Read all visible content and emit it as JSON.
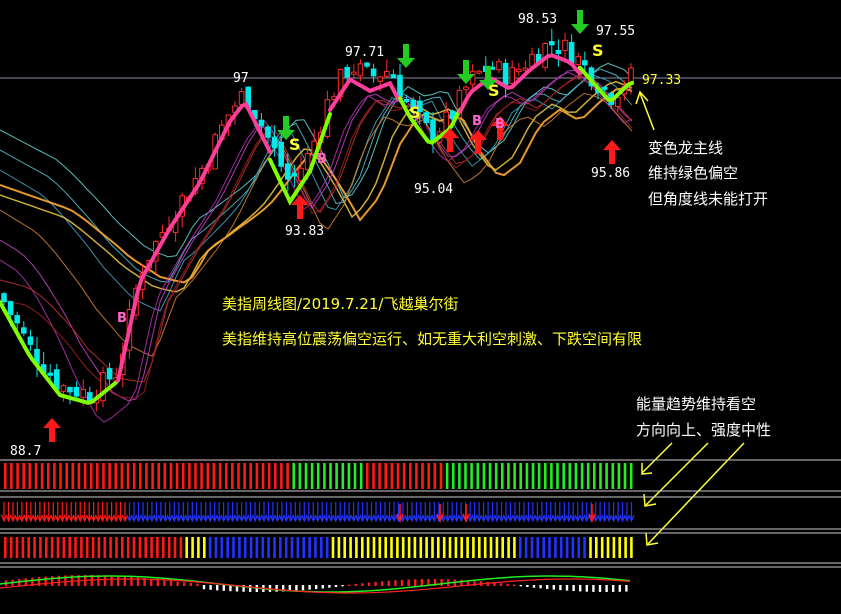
{
  "chart_data": {
    "type": "candlestick",
    "title": "美指周线图/2019.7.21/飞越巢尔街",
    "subtitle": "美指维持高位震荡偏空运行、如无重大利空刺激、下跌空间有限",
    "price_labels": [
      {
        "text": "88.7",
        "value": 88.7
      },
      {
        "text": "97",
        "value": 97.0
      },
      {
        "text": "93.83",
        "value": 93.83
      },
      {
        "text": "97.71",
        "value": 97.71
      },
      {
        "text": "95.04",
        "value": 95.04
      },
      {
        "text": "98.53",
        "value": 98.53
      },
      {
        "text": "97.55",
        "value": 97.55
      },
      {
        "text": "95.86",
        "value": 95.86
      }
    ],
    "last_price": {
      "text": "97.33",
      "value": 97.33
    },
    "ylim": [
      88.2,
      99.3
    ],
    "annotations": {
      "dragon_line": [
        "变色龙主线",
        "维持绿色偏空",
        "但角度线未能打开"
      ],
      "energy": [
        "能量趋势维持看空",
        "方向向上、强度中性"
      ]
    },
    "signals": {
      "buy_label": "B",
      "sell_label": "S"
    },
    "colors": {
      "up": "#ff2a2a",
      "down": "#00e8e8",
      "dragon_bull": "#ff3d9a",
      "dragon_bear": "#7fff00",
      "label": "#ffffff",
      "accent": "#ffff33",
      "buy_arrow": "#ff1a1a",
      "sell_arrow": "#22cc22",
      "strip_red": "#ff1a1a",
      "strip_green": "#22ee22",
      "strip_blue": "#2233ff",
      "strip_yellow": "#ffff00"
    },
    "strips": {
      "strip1": "RRRRRRRRRRRRRRRRRRRRRRRRRRRRRRRRRRRRRRRRRRRRRRRGGGGGGGGGGGGRRRRRRRRRRRRRGGGGGGGGGGGGGGGGGGGGGGGGGGGGGGG",
      "strip2": "RRRRRRRRRRRRRRRRRRRRRRRRRRRRBBBBBBBBBBBBBBBBBBBBBBBBBBBBBBBBBBBBBBBBBBBBBBBBBBBBBBBBBBBBBBBBBBBBBBBBBBBBBBBBBBBBBBBBBBBBBBBBBBBBBBBBBBBBBBBBB",
      "strip3": "RRRRRRRRRRRRRRRRRRRRRRRRRRRRRRRYYYYBBBBBBBBBBBBBBBBBBBBBYYYYYYYYYYYYYYYYYYYYYYYYYYYYYYYYBBBBBBBBBBBBYYYYYYYY"
    }
  }
}
